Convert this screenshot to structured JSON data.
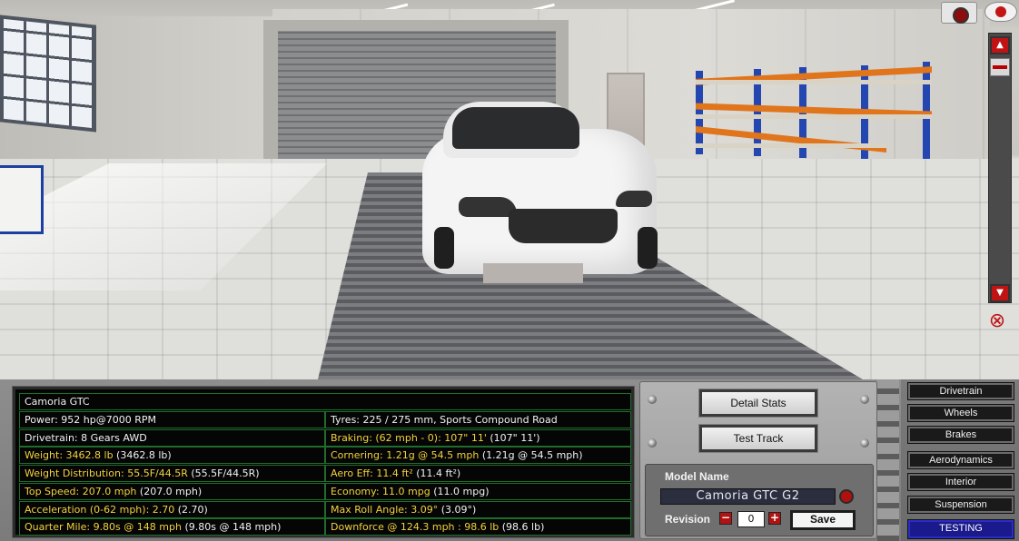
{
  "viewport": {
    "camera_icon": "camera-icon",
    "visibility_icon": "eye-icon",
    "zoom_up_icon": "chevron-up-icon",
    "zoom_down_icon": "chevron-down-icon",
    "hide_ui_icon": "eye-crossed-icon"
  },
  "stats": {
    "title": "Camoria  GTC",
    "left": [
      {
        "label": "Power: 952 hp@7000 RPM",
        "note": "",
        "highlight": false
      },
      {
        "label": "Drivetrain: 8 Gears AWD",
        "note": "",
        "highlight": false
      },
      {
        "label": "Weight: 3462.8 lb",
        "note": " (3462.8 lb)",
        "highlight": true
      },
      {
        "label": "Weight Distribution: 55.5F/44.5R",
        "note": " (55.5F/44.5R)",
        "highlight": true
      },
      {
        "label": "Top Speed: 207.0 mph",
        "note": " (207.0 mph)",
        "highlight": true
      },
      {
        "label": "Acceleration (0-62 mph): 2.70",
        "note": " (2.70)",
        "highlight": true
      },
      {
        "label": "Quarter Mile: 9.80s @ 148 mph",
        "note": " (9.80s @ 148 mph)",
        "highlight": true
      }
    ],
    "right": [
      {
        "label": "Tyres: 225 / 275 mm, Sports Compound Road",
        "note": "",
        "highlight": false
      },
      {
        "label": "Braking: (62 mph - 0): 107\" 11'",
        "note": " (107\" 11')",
        "highlight": true
      },
      {
        "label": "Cornering: 1.21g @ 54.5 mph",
        "note": " (1.21g @ 54.5 mph)",
        "highlight": true
      },
      {
        "label": "Aero Eff: 11.4 ft²",
        "note": " (11.4 ft²)",
        "highlight": true
      },
      {
        "label": "Economy: 11.0 mpg",
        "note": " (11.0 mpg)",
        "highlight": true
      },
      {
        "label": "Max Roll Angle: 3.09°",
        "note": " (3.09°)",
        "highlight": true
      },
      {
        "label": "Downforce @ 124.3 mph : 98.6 lb",
        "note": " (98.6 lb)",
        "highlight": true
      }
    ]
  },
  "actions": {
    "detail_stats": "Detail Stats",
    "test_track": "Test Track"
  },
  "model": {
    "name_label": "Model Name",
    "name_value": "Camoria  GTC G2",
    "revision_label": "Revision",
    "revision_value": "0",
    "minus_label": "−",
    "plus_label": "+",
    "save_label": "Save"
  },
  "menu": {
    "items": [
      "Drivetrain",
      "Wheels",
      "Brakes",
      "Aerodynamics",
      "Interior",
      "Suspension",
      "TESTING"
    ],
    "active": "TESTING"
  },
  "colors": {
    "stat_highlight": "#f2d23c",
    "stat_border": "#1f6d2a",
    "accent_red": "#c01414",
    "active_tab": "#1a1a8c"
  }
}
